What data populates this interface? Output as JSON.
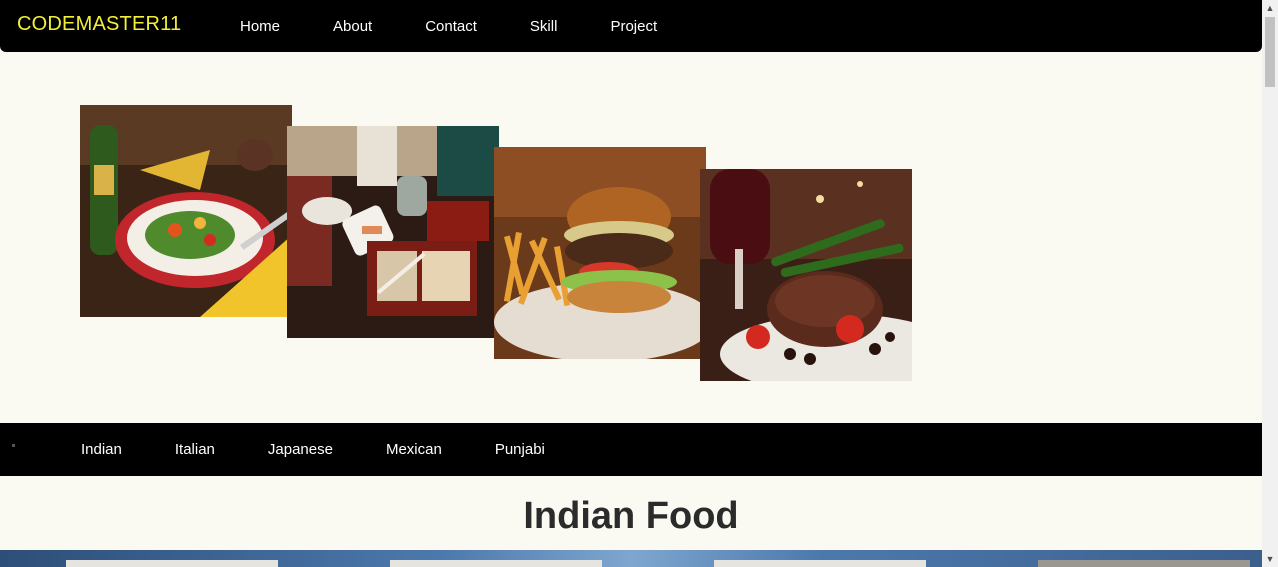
{
  "brand": "CODEMASTER11",
  "nav": {
    "items": [
      "Home",
      "About",
      "Contact",
      "Skill",
      "Project"
    ]
  },
  "hero": {
    "photos": [
      "salad-photo",
      "sushi-table-photo",
      "burger-photo",
      "steak-photo"
    ]
  },
  "cuisines": {
    "items": [
      "Indian",
      "Italian",
      "Japanese",
      "Mexican",
      "Punjabi"
    ]
  },
  "section": {
    "title": "Indian Food"
  },
  "colors": {
    "nav_bg": "#000000",
    "brand": "#f2ef3a",
    "page_bg": "#fafaf3"
  }
}
